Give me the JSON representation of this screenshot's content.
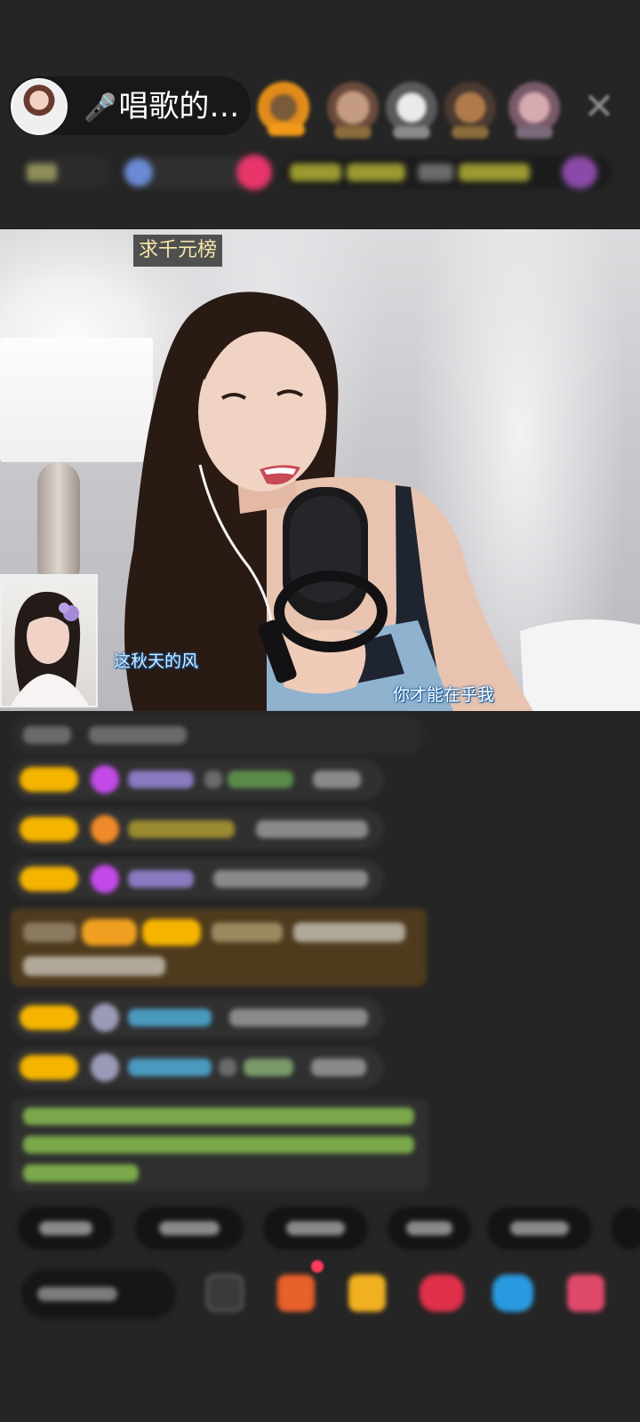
{
  "header": {
    "host_name": "唱歌的…",
    "host_mic_icon": "microphone-icon",
    "close_icon": "close-icon"
  },
  "stream": {
    "rank_badge": "求千元榜",
    "lyrics": {
      "left": "这秋天的风",
      "right": "你才能在乎我"
    }
  },
  "colors": {
    "background": "#252525",
    "level_badge": "#f4b400",
    "rank_badge_text": "#f7e7a8",
    "gift_row": "#4e3b1e",
    "notice_text": "#9bd46a"
  }
}
